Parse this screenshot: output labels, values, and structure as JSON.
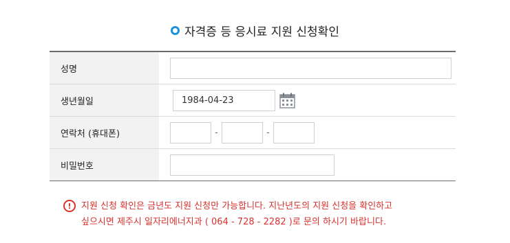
{
  "page": {
    "title": "자격증 등 응시료 지원 신청확인"
  },
  "form": {
    "name_label": "성명",
    "name_value": "",
    "birth_label": "생년월일",
    "birth_value": "1984-04-23",
    "phone_label": "연락처 (휴대폰)",
    "phone_separator": "-",
    "phone_part1": "",
    "phone_part2": "",
    "phone_part3": "",
    "password_label": "비밀번호",
    "password_value": ""
  },
  "notice": {
    "icon_symbol": "!",
    "text": "지원 신청 확인은 금년도 지원 신청만 가능합니다. 지난년도의 지원 신청을 확인하고\n싶으시면 제주시 일자리에너지과 ( 064 - 728 - 2282 )로 문의 하시기 바랍니다."
  },
  "colors": {
    "accent": "#1d8fe0",
    "notice": "#d9312c",
    "label_bg": "#f2f2f2"
  },
  "icons": {
    "title_bullet": "circle-bullet-icon",
    "calendar": "calendar-icon",
    "notice": "exclamation-circle-icon"
  }
}
